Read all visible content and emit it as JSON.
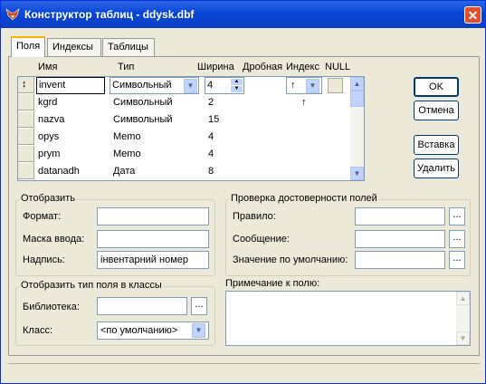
{
  "window": {
    "title": "Конструктор таблиц - ddysk.dbf",
    "close": "✕"
  },
  "tabs": [
    "Поля",
    "Индексы",
    "Таблицы"
  ],
  "grid": {
    "headers": {
      "name": "Имя",
      "type": "Тип",
      "width": "Ширина",
      "decimal": "Дробная",
      "index": "Индекс",
      "null": "NULL"
    },
    "rows": [
      {
        "name": "invent",
        "type": "Символьный",
        "width": "4",
        "index": "↑"
      },
      {
        "name": "kgrd",
        "type": "Символьный",
        "width": "2",
        "index": "↑"
      },
      {
        "name": "nazva",
        "type": "Символьный",
        "width": "15",
        "index": ""
      },
      {
        "name": "opys",
        "type": "Memo",
        "width": "4",
        "index": ""
      },
      {
        "name": "prym",
        "type": "Memo",
        "width": "4",
        "index": ""
      },
      {
        "name": "datanadh",
        "type": "Дата",
        "width": "8",
        "index": ""
      }
    ],
    "row_marker": "↕"
  },
  "buttons": {
    "ok": "OK",
    "cancel": "Отмена",
    "insert": "Вставка",
    "delete": "Удалить"
  },
  "display": {
    "legend": "Отобразить",
    "format_label": "Формат:",
    "format_value": "",
    "mask_label": "Маска ввода:",
    "mask_value": "",
    "caption_label": "Надпись:",
    "caption_value": "інвентарний номер"
  },
  "validation": {
    "legend": "Проверка достоверности полей",
    "rule_label": "Правило:",
    "rule_value": "",
    "message_label": "Сообщение:",
    "message_value": "",
    "default_label": "Значение по умолчанию:",
    "default_value": ""
  },
  "mapping": {
    "legend": "Отобразить тип поля в классы",
    "library_label": "Библиотека:",
    "library_value": "",
    "class_label": "Класс:",
    "class_value": "<по умолчанию>"
  },
  "comment": {
    "label": "Примечание к полю:",
    "value": ""
  },
  "dots": "...",
  "colors": {
    "title_bar": "#0a46d6",
    "close_button": "#e24f2b",
    "window_bg": "#ece9d8"
  }
}
